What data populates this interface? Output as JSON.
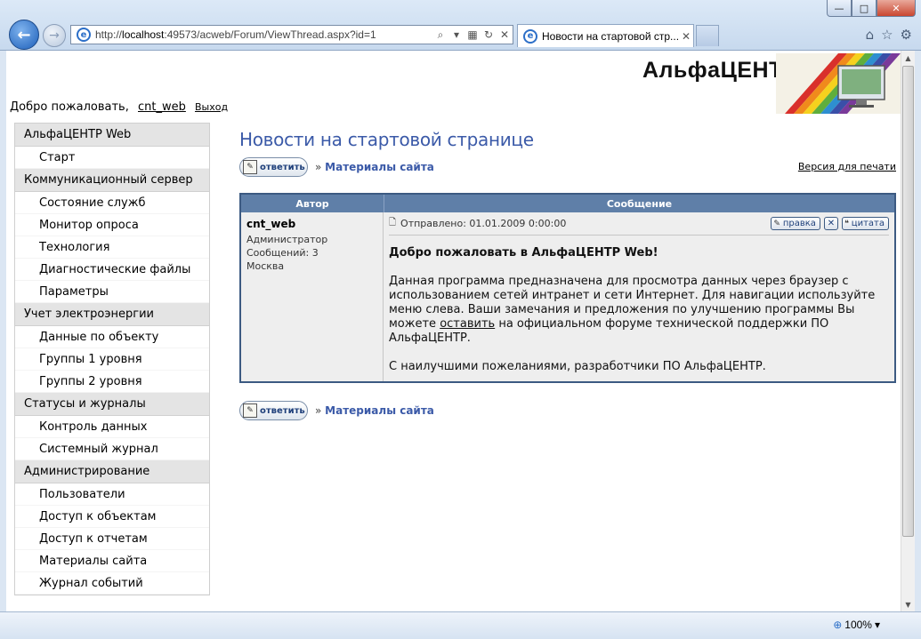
{
  "browser": {
    "url_prefix": "http://",
    "url_host": "localhost",
    "url_rest": ":49573/acweb/Forum/ViewThread.aspx?id=1",
    "tab_title": "Новости на стартовой стр...",
    "zoom": "100%"
  },
  "header": {
    "logo_text": "АльфаЦЕНТР",
    "logo_tm": "™",
    "welcome": "Добро пожаловать,",
    "username": "cnt_web",
    "logout": "Выход"
  },
  "sidebar": {
    "groups": [
      {
        "label": "АльфаЦЕНТР Web",
        "items": [
          "Старт"
        ]
      },
      {
        "label": "Коммуникационный сервер",
        "items": [
          "Состояние служб",
          "Монитор опроса",
          "Технология",
          "Диагностические файлы",
          "Параметры"
        ]
      },
      {
        "label": "Учет электроэнергии",
        "items": [
          "Данные по объекту",
          "Группы 1 уровня",
          "Группы 2 уровня"
        ]
      },
      {
        "label": "Статусы и журналы",
        "items": [
          "Контроль данных",
          "Системный журнал"
        ]
      },
      {
        "label": "Администрирование",
        "items": [
          "Пользователи",
          "Доступ к объектам",
          "Доступ к отчетам",
          "Материалы сайта",
          "Журнал событий"
        ]
      }
    ]
  },
  "main": {
    "title": "Новости на стартовой странице",
    "reply_label": "ответить",
    "crumb_sep": "»",
    "crumb_link": "Материалы сайта",
    "print_link": "Версия для печати",
    "table": {
      "col_author": "Автор",
      "col_message": "Сообщение"
    },
    "post": {
      "author": "cnt_web",
      "role": "Администратор",
      "posts_count": "Сообщений: 3",
      "location": "Москва",
      "sent": "Отправлено: 01.01.2009 0:00:00",
      "edit_label": "правка",
      "delete_label": "✕",
      "quote_label": "цитата",
      "heading": "Добро пожаловать в АльфаЦЕНТР Web!",
      "body_before_link": "Данная программа предназначена для просмотра данных через браузер с использованием сетей интранет и сети Интернет. Для навигации используйте меню слева. Ваши замечания и предложения по улучшению программы Вы можете",
      "body_link": "оставить",
      "body_after_link": "на официальном форуме технической поддержки ПО АльфаЦЕНТР.",
      "signature": "С наилучшими пожеланиями, разработчики ПО АльфаЦЕНТР."
    }
  }
}
